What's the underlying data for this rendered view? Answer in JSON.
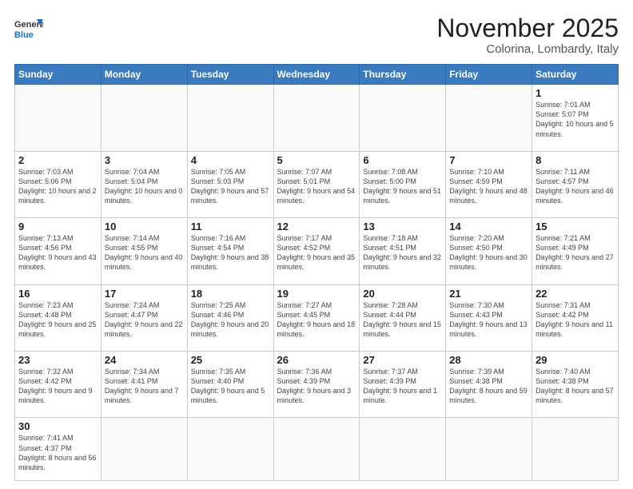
{
  "header": {
    "logo_general": "General",
    "logo_blue": "Blue",
    "month_year": "November 2025",
    "location": "Colorina, Lombardy, Italy"
  },
  "days_of_week": [
    "Sunday",
    "Monday",
    "Tuesday",
    "Wednesday",
    "Thursday",
    "Friday",
    "Saturday"
  ],
  "weeks": [
    [
      {
        "num": "",
        "info": ""
      },
      {
        "num": "",
        "info": ""
      },
      {
        "num": "",
        "info": ""
      },
      {
        "num": "",
        "info": ""
      },
      {
        "num": "",
        "info": ""
      },
      {
        "num": "",
        "info": ""
      },
      {
        "num": "1",
        "info": "Sunrise: 7:01 AM\nSunset: 5:07 PM\nDaylight: 10 hours\nand 5 minutes."
      }
    ],
    [
      {
        "num": "2",
        "info": "Sunrise: 7:03 AM\nSunset: 5:06 PM\nDaylight: 10 hours\nand 2 minutes."
      },
      {
        "num": "3",
        "info": "Sunrise: 7:04 AM\nSunset: 5:04 PM\nDaylight: 10 hours\nand 0 minutes."
      },
      {
        "num": "4",
        "info": "Sunrise: 7:05 AM\nSunset: 5:03 PM\nDaylight: 9 hours\nand 57 minutes."
      },
      {
        "num": "5",
        "info": "Sunrise: 7:07 AM\nSunset: 5:01 PM\nDaylight: 9 hours\nand 54 minutes."
      },
      {
        "num": "6",
        "info": "Sunrise: 7:08 AM\nSunset: 5:00 PM\nDaylight: 9 hours\nand 51 minutes."
      },
      {
        "num": "7",
        "info": "Sunrise: 7:10 AM\nSunset: 4:59 PM\nDaylight: 9 hours\nand 48 minutes."
      },
      {
        "num": "8",
        "info": "Sunrise: 7:11 AM\nSunset: 4:57 PM\nDaylight: 9 hours\nand 46 minutes."
      }
    ],
    [
      {
        "num": "9",
        "info": "Sunrise: 7:13 AM\nSunset: 4:56 PM\nDaylight: 9 hours\nand 43 minutes."
      },
      {
        "num": "10",
        "info": "Sunrise: 7:14 AM\nSunset: 4:55 PM\nDaylight: 9 hours\nand 40 minutes."
      },
      {
        "num": "11",
        "info": "Sunrise: 7:16 AM\nSunset: 4:54 PM\nDaylight: 9 hours\nand 38 minutes."
      },
      {
        "num": "12",
        "info": "Sunrise: 7:17 AM\nSunset: 4:52 PM\nDaylight: 9 hours\nand 35 minutes."
      },
      {
        "num": "13",
        "info": "Sunrise: 7:18 AM\nSunset: 4:51 PM\nDaylight: 9 hours\nand 32 minutes."
      },
      {
        "num": "14",
        "info": "Sunrise: 7:20 AM\nSunset: 4:50 PM\nDaylight: 9 hours\nand 30 minutes."
      },
      {
        "num": "15",
        "info": "Sunrise: 7:21 AM\nSunset: 4:49 PM\nDaylight: 9 hours\nand 27 minutes."
      }
    ],
    [
      {
        "num": "16",
        "info": "Sunrise: 7:23 AM\nSunset: 4:48 PM\nDaylight: 9 hours\nand 25 minutes."
      },
      {
        "num": "17",
        "info": "Sunrise: 7:24 AM\nSunset: 4:47 PM\nDaylight: 9 hours\nand 22 minutes."
      },
      {
        "num": "18",
        "info": "Sunrise: 7:25 AM\nSunset: 4:46 PM\nDaylight: 9 hours\nand 20 minutes."
      },
      {
        "num": "19",
        "info": "Sunrise: 7:27 AM\nSunset: 4:45 PM\nDaylight: 9 hours\nand 18 minutes."
      },
      {
        "num": "20",
        "info": "Sunrise: 7:28 AM\nSunset: 4:44 PM\nDaylight: 9 hours\nand 15 minutes."
      },
      {
        "num": "21",
        "info": "Sunrise: 7:30 AM\nSunset: 4:43 PM\nDaylight: 9 hours\nand 13 minutes."
      },
      {
        "num": "22",
        "info": "Sunrise: 7:31 AM\nSunset: 4:42 PM\nDaylight: 9 hours\nand 11 minutes."
      }
    ],
    [
      {
        "num": "23",
        "info": "Sunrise: 7:32 AM\nSunset: 4:42 PM\nDaylight: 9 hours\nand 9 minutes."
      },
      {
        "num": "24",
        "info": "Sunrise: 7:34 AM\nSunset: 4:41 PM\nDaylight: 9 hours\nand 7 minutes."
      },
      {
        "num": "25",
        "info": "Sunrise: 7:35 AM\nSunset: 4:40 PM\nDaylight: 9 hours\nand 5 minutes."
      },
      {
        "num": "26",
        "info": "Sunrise: 7:36 AM\nSunset: 4:39 PM\nDaylight: 9 hours\nand 3 minutes."
      },
      {
        "num": "27",
        "info": "Sunrise: 7:37 AM\nSunset: 4:39 PM\nDaylight: 9 hours\nand 1 minute."
      },
      {
        "num": "28",
        "info": "Sunrise: 7:39 AM\nSunset: 4:38 PM\nDaylight: 8 hours\nand 59 minutes."
      },
      {
        "num": "29",
        "info": "Sunrise: 7:40 AM\nSunset: 4:38 PM\nDaylight: 8 hours\nand 57 minutes."
      }
    ],
    [
      {
        "num": "30",
        "info": "Sunrise: 7:41 AM\nSunset: 4:37 PM\nDaylight: 8 hours\nand 56 minutes."
      },
      {
        "num": "",
        "info": ""
      },
      {
        "num": "",
        "info": ""
      },
      {
        "num": "",
        "info": ""
      },
      {
        "num": "",
        "info": ""
      },
      {
        "num": "",
        "info": ""
      },
      {
        "num": "",
        "info": ""
      }
    ]
  ]
}
